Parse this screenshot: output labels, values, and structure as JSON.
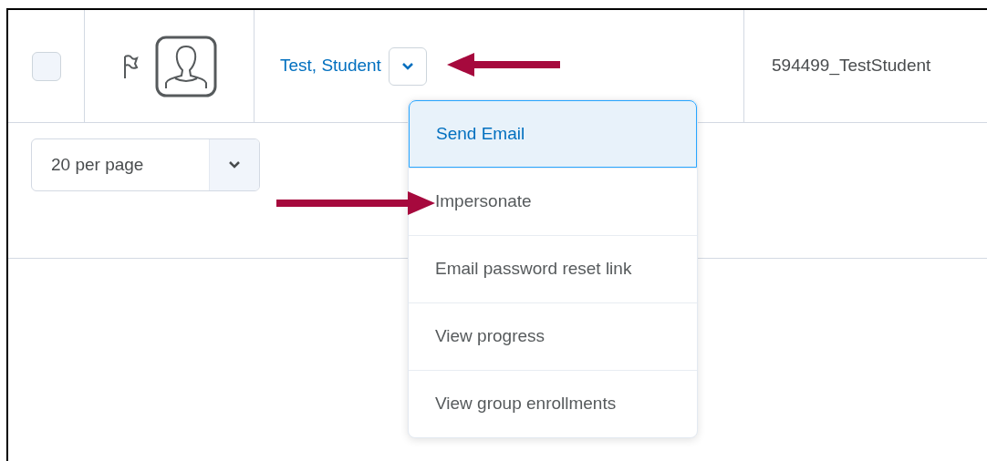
{
  "row": {
    "checked": false,
    "name": "Test, Student",
    "username": "594499_TestStudent"
  },
  "page_size": {
    "value": "20 per page"
  },
  "menu": [
    {
      "label": "Send Email",
      "selected": true
    },
    {
      "label": "Impersonate",
      "selected": false
    },
    {
      "label": "Email password reset link",
      "selected": false
    },
    {
      "label": "View progress",
      "selected": false
    },
    {
      "label": "View group enrollments",
      "selected": false
    }
  ]
}
